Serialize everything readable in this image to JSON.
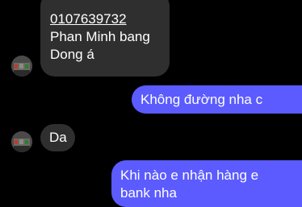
{
  "messages": [
    {
      "direction": "incoming",
      "lines": [
        "0107639732",
        "Phan Minh bang",
        "Dong á"
      ]
    },
    {
      "direction": "outgoing",
      "text": "Không đường nha c"
    },
    {
      "direction": "incoming",
      "text": "Da"
    },
    {
      "direction": "outgoing",
      "lines": [
        "Khi nào e nhận hàng e",
        "bank nha"
      ]
    }
  ],
  "avatar_icon": "contact-avatar-icon",
  "colors": {
    "background": "#000000",
    "incoming_bubble": "#2f2f2f",
    "outgoing_bubble": "#5b5bff",
    "text": "#ffffff"
  }
}
